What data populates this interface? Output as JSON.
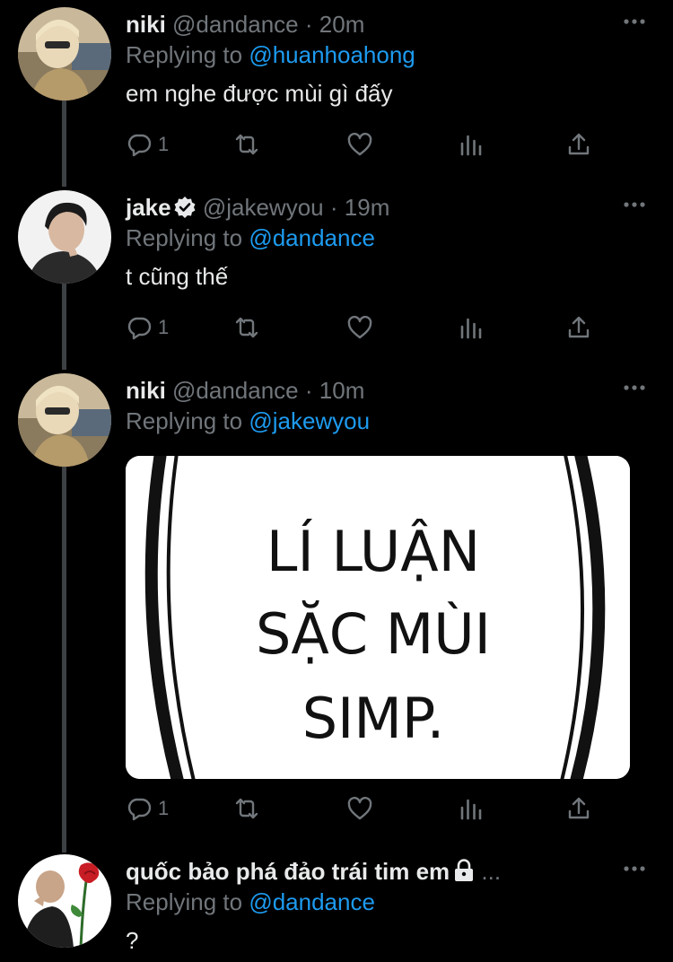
{
  "tweets": [
    {
      "name": "niki",
      "handle": "@dandance",
      "dot": "·",
      "time": "20m",
      "replying_prefix": "Replying to ",
      "replying_to": "@huanhoahong",
      "text": "em nghe được mùi gì đấy",
      "reply_count": "1"
    },
    {
      "name": "jake",
      "verified": true,
      "handle": "@jakewyou",
      "dot": "·",
      "time": "19m",
      "replying_prefix": "Replying to ",
      "replying_to": "@dandance",
      "text": "t cũng thế",
      "reply_count": "1"
    },
    {
      "name": "niki",
      "handle": "@dandance",
      "dot": "·",
      "time": "10m",
      "replying_prefix": "Replying to ",
      "replying_to": "@jakewyou",
      "media_text": [
        "LÍ LUẬN",
        "SẶC MÙI",
        "SIMP."
      ],
      "reply_count": "1"
    },
    {
      "name": "quốc bảo phá đảo trái tim em",
      "protected": true,
      "truncation": "...",
      "replying_prefix": "Replying to ",
      "replying_to": "@dandance",
      "text": "?"
    }
  ],
  "icons": {
    "reply": "reply-icon",
    "retweet": "retweet-icon",
    "like": "heart-icon",
    "analytics": "analytics-icon",
    "share": "share-icon",
    "more": "more-icon",
    "verified": "verified-badge-icon",
    "lock": "lock-icon"
  },
  "colors": {
    "background": "#000000",
    "text": "#e7e9ea",
    "muted": "#71767b",
    "link": "#1d9bf0",
    "thread_line": "#3e4144"
  }
}
